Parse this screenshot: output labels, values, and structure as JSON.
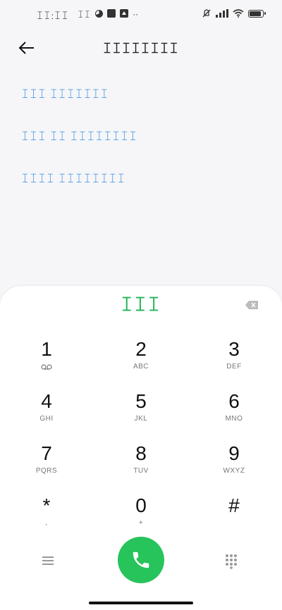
{
  "status_bar": {
    "time": "ꀤꀤ:ꀤꀤ",
    "notif_text": "ꀤꀤ",
    "overflow": "··"
  },
  "header": {
    "title": "ꀤꀤꀤꀤꀤꀤꀤꀤ"
  },
  "options": [
    {
      "label": "ꀤꀤꀤ ꀤꀤꀤꀤꀤꀤꀤ"
    },
    {
      "label": "ꀤꀤꀤ ꀤꀤ ꀤꀤꀤꀤꀤꀤꀤꀤ"
    },
    {
      "label": "ꀤꀤꀤꀤ ꀤꀤꀤꀤꀤꀤꀤꀤ"
    }
  ],
  "dialpad": {
    "number": "ꀤꀤꀤ",
    "keys": [
      {
        "digit": "1",
        "letters": ""
      },
      {
        "digit": "2",
        "letters": "ABC"
      },
      {
        "digit": "3",
        "letters": "DEF"
      },
      {
        "digit": "4",
        "letters": "GHI"
      },
      {
        "digit": "5",
        "letters": "JKL"
      },
      {
        "digit": "6",
        "letters": "MNO"
      },
      {
        "digit": "7",
        "letters": "PQRS"
      },
      {
        "digit": "8",
        "letters": "TUV"
      },
      {
        "digit": "9",
        "letters": "WXYZ"
      },
      {
        "digit": "*",
        "letters": ","
      },
      {
        "digit": "0",
        "letters": "+"
      },
      {
        "digit": "#",
        "letters": ""
      }
    ]
  },
  "colors": {
    "accent_green": "#27c35b",
    "link_blue": "#3a8ee0",
    "number_green": "#22b35a"
  },
  "icons": {
    "back": "arrow-left-icon",
    "backspace": "backspace-icon",
    "menu": "menu-icon",
    "call": "phone-icon",
    "keypad": "dialpad-grid-icon",
    "voicemail": "voicemail-icon"
  }
}
